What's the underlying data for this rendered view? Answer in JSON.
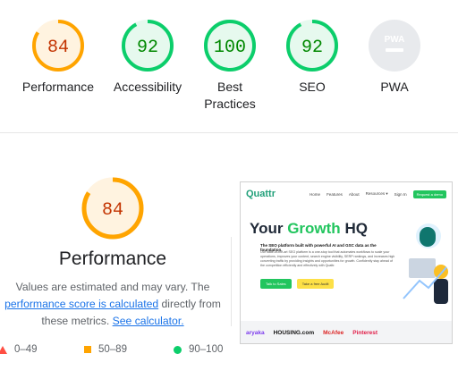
{
  "categories": [
    {
      "label": "Performance",
      "score": "84",
      "value": 84,
      "color": "#ffa400",
      "ring": "#ffa400",
      "bg": "#fff3e0"
    },
    {
      "label": "Accessibility",
      "score": "92",
      "value": 92,
      "color": "#008800",
      "ring": "#0cce6b",
      "bg": "#e6f9ee"
    },
    {
      "label": "Best Practices",
      "label_line1": "Best",
      "label_line2": "Practices",
      "score": "100",
      "value": 100,
      "color": "#008800",
      "ring": "#0cce6b",
      "bg": "#e6f9ee"
    },
    {
      "label": "SEO",
      "score": "92",
      "value": 92,
      "color": "#008800",
      "ring": "#0cce6b",
      "bg": "#e6f9ee"
    },
    {
      "label": "PWA",
      "badge": "PWA",
      "color": "#9aa0a6",
      "bg": "#e8eaed"
    }
  ],
  "performance": {
    "score": "84",
    "value": 84,
    "title": "Performance",
    "desc_prefix": "Values are estimated and may vary. The",
    "desc_link1": "performance score is calculated",
    "desc_mid": "directly from these metrics.",
    "desc_link2": "See calculator."
  },
  "legend": [
    {
      "range": "0–49",
      "color": "#ff4e42",
      "icon": "triangle-icon"
    },
    {
      "range": "50–89",
      "color": "#ffa400",
      "icon": "square-icon"
    },
    {
      "range": "90–100",
      "color": "#0cce6b",
      "icon": "circle-icon"
    }
  ],
  "screenshot": {
    "logo": "Quattr",
    "nav": [
      "Home",
      "Features",
      "About",
      "Resources ▾",
      "Sign In"
    ],
    "nav_cta": "Request a demo",
    "hero_part1": "Your",
    "hero_highlight": "Growth",
    "hero_part2": "HQ",
    "subheading": "The SEO platform built with powerful AI and GSC data as the foundation.",
    "body": "Our state-of-the-art SEO platform is a one-stop tool that automates workflows to scale your operations, improves your content, search engine visibility, SERP rankings, and increases high converting traffic by providing insights and opportunities for growth. Confidently stay ahead of the competition efficiently and effectively with Quattr.",
    "btn_primary": "Talk to Sales",
    "btn_secondary": "Take a free Audit",
    "client_logos": [
      "aryaka",
      "HOUSING.com",
      "McAfee",
      "Pinterest"
    ]
  }
}
